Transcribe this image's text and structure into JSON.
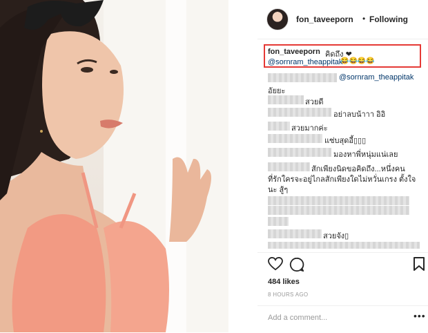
{
  "post": {
    "username": "fon_taveeporn",
    "dot": "•",
    "follow_status": "Following",
    "caption_text": "คิดถึง ❤",
    "caption_mention": "@sornram_theappitak",
    "caption_emoji": "😂😂😂😂"
  },
  "comments": [
    {
      "text": "@sornram_theappitak"
    },
    {
      "text": "อัยยะ"
    },
    {
      "text": "สวยดี"
    },
    {
      "text": "อย่าลบน้าาา อิอิ"
    },
    {
      "text": "สวยมากค่ะ"
    },
    {
      "text": "แซ่บสุดอี้▯▯▯"
    },
    {
      "text": "มองหาพี่หนุ่มแน่เลย"
    },
    {
      "text": "สักเพียงนิดขอคิดถึง...หนึ่งคน"
    },
    {
      "text": "ที่รักใครจะอยู่ไกลสักเพียงใดไม่หวั่นเกรง ตั้งใจ"
    },
    {
      "text": "นะ สู้ๆ"
    },
    {
      "text": "สวยจัง▯"
    }
  ],
  "stats": {
    "likes": "484 likes",
    "time": "8 HOURS AGO"
  },
  "comment_box": {
    "placeholder": "Add a comment...",
    "more": "•••"
  },
  "icons": {
    "like": "heart-icon",
    "comment": "comment-bubble-icon",
    "save": "bookmark-icon",
    "more": "more-options-icon"
  },
  "colors": {
    "highlight_box": "#e53935",
    "mention": "#003569",
    "muted": "#999999"
  }
}
